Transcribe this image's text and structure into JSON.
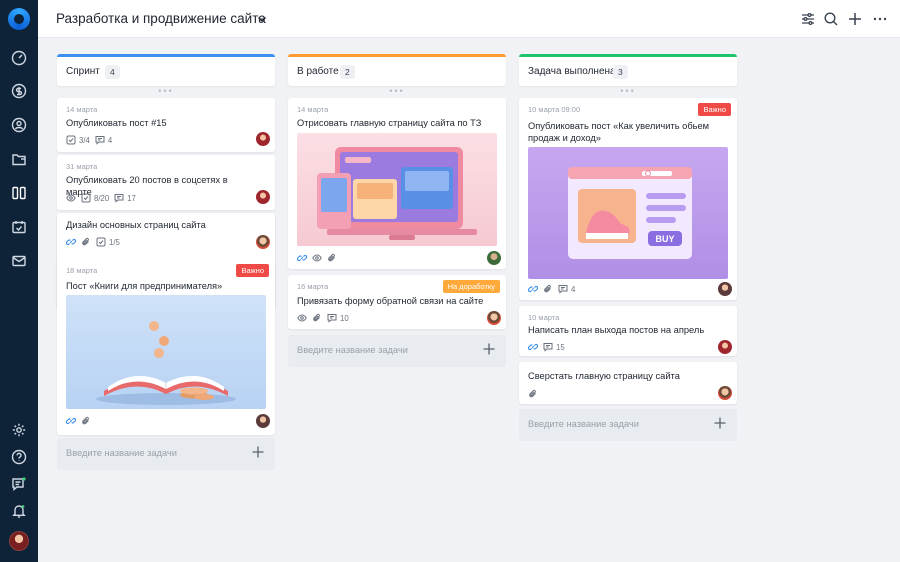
{
  "header": {
    "title": "Разработка и продвижение сайта",
    "icons": [
      "chevron-down-icon",
      "filter-icon",
      "search-icon",
      "plus-icon",
      "more-icon"
    ]
  },
  "sidebar": {
    "icons": [
      "logo-icon",
      "dashboard-icon",
      "finance-icon",
      "user-icon",
      "folder-icon",
      "kanban-icon",
      "calendar-icon",
      "mail-icon",
      "settings-icon",
      "help-icon",
      "chat-icon",
      "bell-icon"
    ]
  },
  "colors": {
    "sprint": "#3b8ff0",
    "in_work": "#ff9a33",
    "done": "#20c46a",
    "important": "#ef4a45",
    "rework": "#ffa93a",
    "sidebar": "#0e2238"
  },
  "columns": [
    {
      "title": "Спринт",
      "count": "4",
      "add_placeholder": "Введите название задачи",
      "cards": [
        {
          "date": "14 марта",
          "title": "Опубликовать пост #15",
          "checklist": "3/4",
          "comments": "4"
        },
        {
          "date": "31 марта",
          "title": "Опубликовать 20 постов в соцсетях в марте",
          "checklist": "8/20",
          "comments": "17"
        },
        {
          "title": "Дизайн основных страниц сайта",
          "checklist": "1/5"
        },
        {
          "date": "18 марта",
          "badge": "Важно",
          "title": "Пост «Книги для предпринимателя»"
        }
      ]
    },
    {
      "title": "В работе",
      "count": "2",
      "add_placeholder": "Введите название задачи",
      "cards": [
        {
          "date": "14 марта",
          "title": "Отрисовать главную страницу сайта по ТЗ"
        },
        {
          "date": "16 марта",
          "badge": "На доработку",
          "title": "Привязать форму обратной связи на сайте",
          "comments": "10"
        }
      ]
    },
    {
      "title": "Задача выполнена",
      "count": "3",
      "add_placeholder": "Введите название задачи",
      "cards": [
        {
          "date": "10 марта 09:00",
          "badge": "Важно",
          "title": "Опубликовать пост «Как увеличить обьем продаж и доход»",
          "comments": "4",
          "image_text": "BUY"
        },
        {
          "date": "10 марта",
          "title": "Написать план выхода постов на апрель",
          "comments": "15"
        },
        {
          "title": "Сверстать главную страницу сайта"
        }
      ]
    }
  ]
}
